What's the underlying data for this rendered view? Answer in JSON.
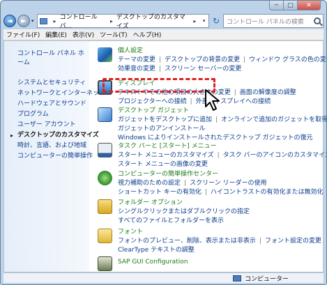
{
  "window": {
    "controls": {
      "minimize": "─",
      "maximize": "□",
      "close": "✕"
    }
  },
  "nav": {
    "back": "◄",
    "forward": "►",
    "dropdown": "▾"
  },
  "address": {
    "segments": [
      "コントロール パ...",
      "デスクトップのカスタマイズ"
    ],
    "separator": "▸",
    "refresh": "↻"
  },
  "search": {
    "placeholder": "コントロール パネルの検索"
  },
  "menu": [
    "ファイル(F)",
    "編集(E)",
    "表示(V)",
    "ツール(T)",
    "ヘルプ(H)"
  ],
  "sidebar": {
    "home": "コントロール パネル ホーム",
    "items": [
      "システムとセキュリティ",
      "ネットワークとインターネット",
      "ハードウェアとサウンド",
      "プログラム",
      "ユーザー アカウント",
      "デスクトップのカスタマイズ",
      "時計、言語、および地域",
      "コンピューターの簡単操作"
    ]
  },
  "categories": [
    {
      "title": "個人設定",
      "lines": [
        [
          "テーマの変更",
          "デスクトップの背景の変更",
          "ウィンドウ グラスの色の変更"
        ],
        [
          "効果音の変更",
          "スクリーン セーバーの変更"
        ]
      ]
    },
    {
      "title": "ディスプレイ",
      "lines": [
        [
          "テキストやその他の項目の大きさの変更",
          "画面の解像度の調整"
        ],
        [
          "プロジェクターへの接続",
          "外部ディスプレイへの接続"
        ]
      ]
    },
    {
      "title": "デスクトップ ガジェット",
      "lines": [
        [
          "ガジェットをデスクトップに追加",
          "オンラインで追加のガジェットを取得"
        ],
        [
          "ガジェットのアンインストール"
        ],
        [
          "Windows によりインストールされたデスクトップ ガジェットの復元"
        ]
      ]
    },
    {
      "title": "タスク バーと [スタート] メニュー",
      "lines": [
        [
          "スタート メニューのカスタマイズ",
          "タスク バーのアイコンのカスタマイズ"
        ],
        [
          "スタート メニューの画像の変更"
        ]
      ]
    },
    {
      "title": "コンピューターの簡単操作センター",
      "lines": [
        [
          "視力補助のための設定",
          "スクリーン リーダーの使用"
        ],
        [
          "ショートカット キーの有効化",
          "ハイコントラストの有効化または無効化"
        ]
      ]
    },
    {
      "title": "フォルダー オプション",
      "lines": [
        [
          "シングルクリックまたはダブルクリックの指定"
        ],
        [
          "すべてのファイルとフォルダーを表示"
        ]
      ]
    },
    {
      "title": "フォント",
      "lines": [
        [
          "フォントのプレビュー、削除、表示または非表示",
          "フォント設定の変更"
        ],
        [
          "ClearType テキストの調整"
        ]
      ]
    },
    {
      "title": "SAP GUI Configuration",
      "lines": []
    }
  ],
  "statusbar": {
    "label": "コンピューター"
  },
  "icon_colors": [
    "#3d8ad9",
    "#2b6fc2",
    "#3b7fd0",
    "#2e62a8",
    "#3d9b3d",
    "#e0b63a",
    "#e8c84a",
    "#5a6b4a"
  ]
}
